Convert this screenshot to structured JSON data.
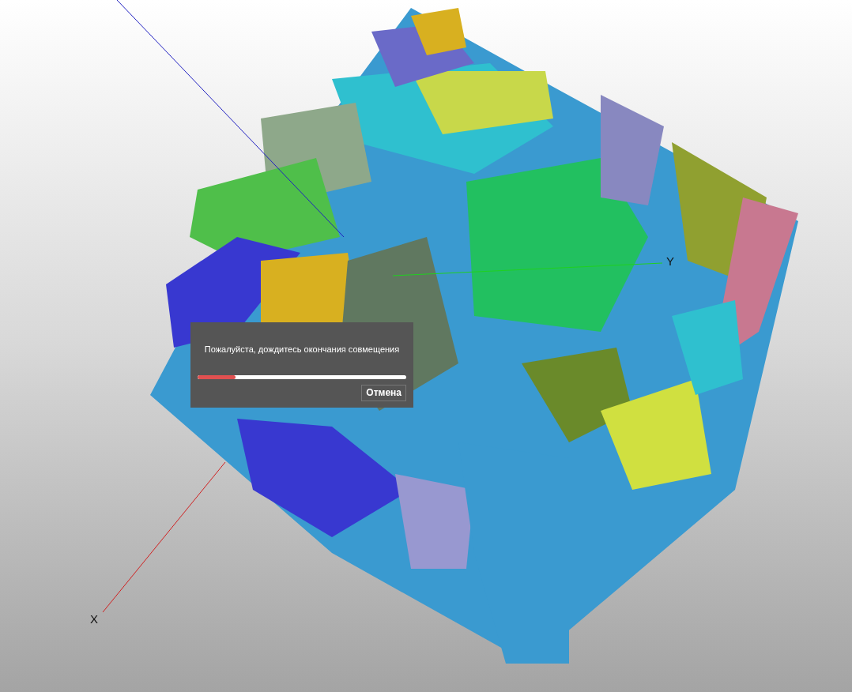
{
  "viewport": {
    "axes": [
      {
        "label": "X"
      },
      {
        "label": "Y"
      }
    ]
  },
  "dialog": {
    "message": "Пожалуйста, дождитесь окончания совмещения",
    "progress": {
      "level": 0.18
    },
    "buttons": [
      "Отмена"
    ]
  }
}
